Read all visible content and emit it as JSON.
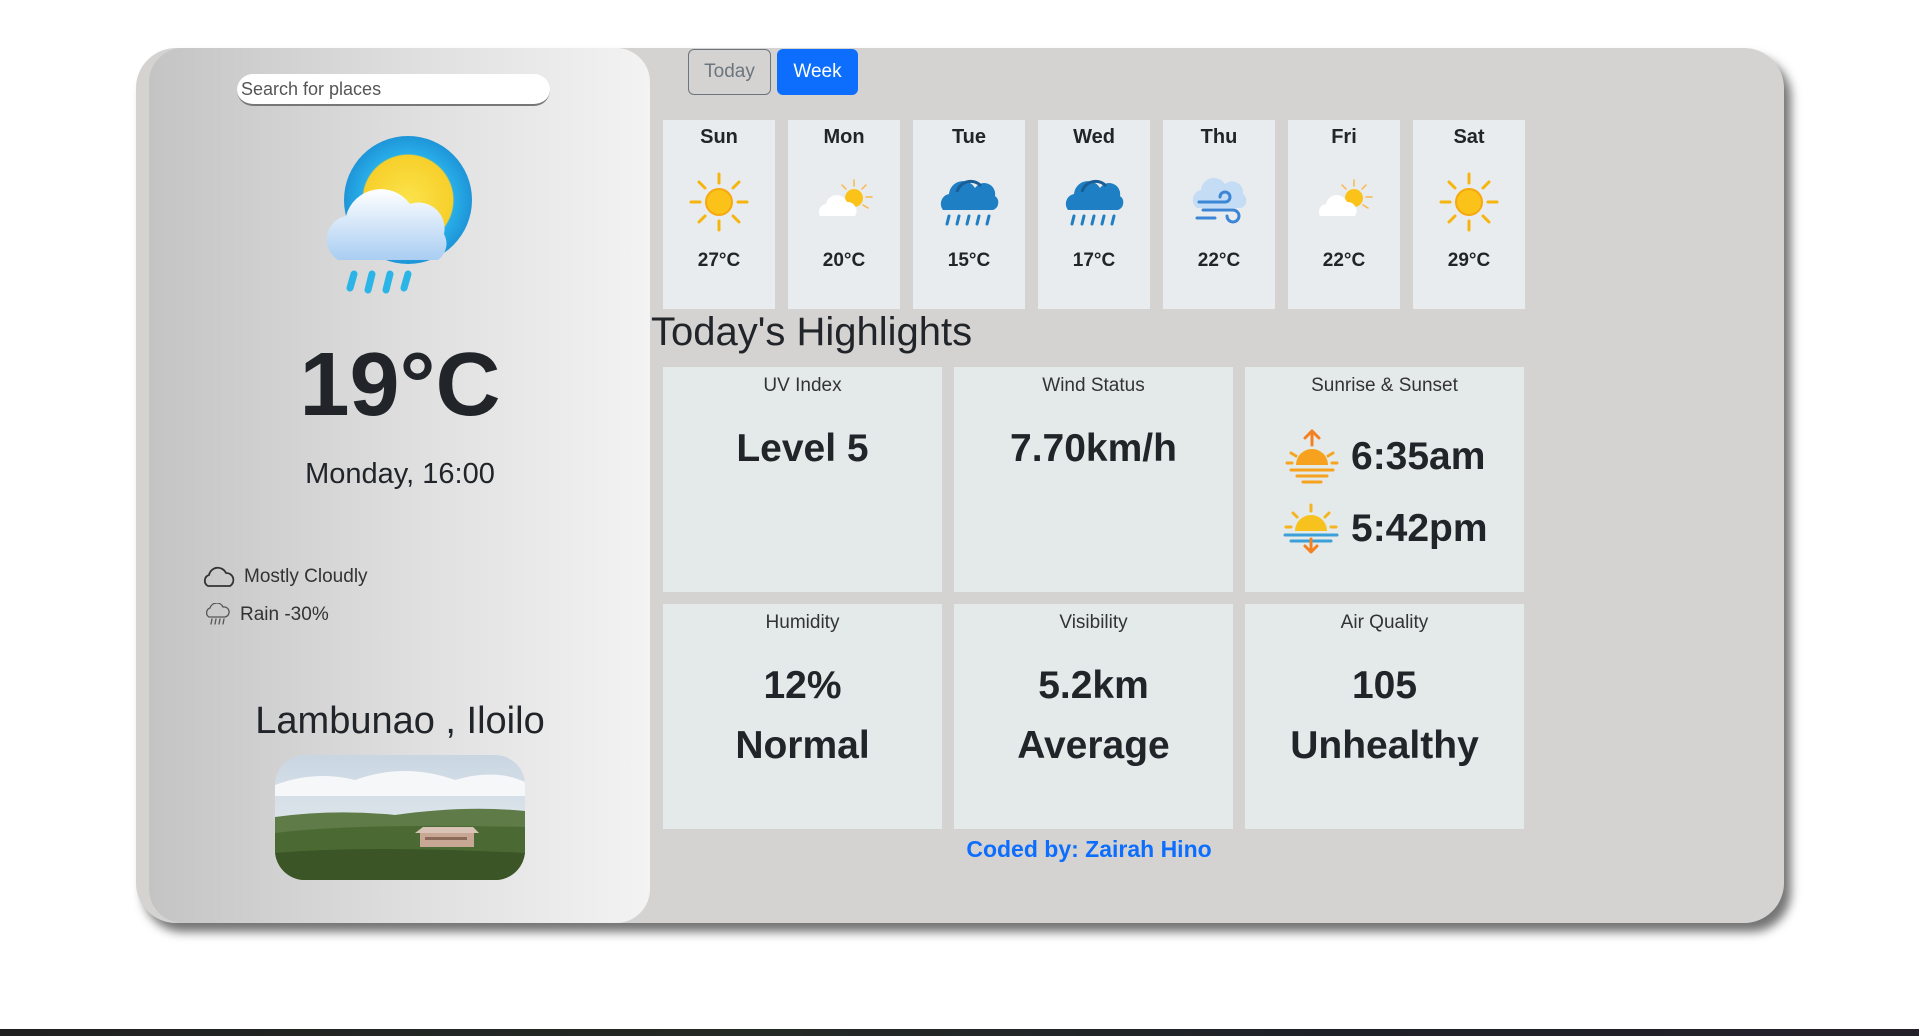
{
  "search": {
    "placeholder": "Search for places"
  },
  "current": {
    "icon": "cloud-rain-sun-icon",
    "temperature": "19°C",
    "datetime": "Monday, 16:00",
    "condition": "Mostly Cloudly",
    "rain": "Rain -30%",
    "location": "Lambunao , Iloilo"
  },
  "tabs": {
    "today": "Today",
    "week": "Week",
    "active": "week"
  },
  "forecast": [
    {
      "day": "Sun",
      "temp": "27°C",
      "icon": "sun-icon"
    },
    {
      "day": "Mon",
      "temp": "20°C",
      "icon": "partly-cloudy-icon"
    },
    {
      "day": "Tue",
      "temp": "15°C",
      "icon": "rain-cloud-icon"
    },
    {
      "day": "Wed",
      "temp": "17°C",
      "icon": "rain-cloud-icon"
    },
    {
      "day": "Thu",
      "temp": "22°C",
      "icon": "wind-cloud-icon"
    },
    {
      "day": "Fri",
      "temp": "22°C",
      "icon": "partly-cloudy-icon"
    },
    {
      "day": "Sat",
      "temp": "29°C",
      "icon": "sun-icon"
    }
  ],
  "highlights": {
    "title": "Today's Highlights",
    "uv": {
      "label": "UV Index",
      "value": "Level 5"
    },
    "wind": {
      "label": "Wind Status",
      "value": "7.70km/h"
    },
    "sun": {
      "label": "Sunrise & Sunset",
      "sunrise": "6:35am",
      "sunset": "5:42pm"
    },
    "humidity": {
      "label": "Humidity",
      "value": "12%",
      "status": "Normal"
    },
    "visibility": {
      "label": "Visibility",
      "value": "5.2km",
      "status": "Average"
    },
    "air": {
      "label": "Air Quality",
      "value": "105",
      "status": "Unhealthy"
    }
  },
  "footer": {
    "credit": "Coded by: Zairah Hino"
  },
  "colors": {
    "accent": "#0d6efd",
    "panel": "#d4d3d2",
    "card": "#e9ecef",
    "highlight_card": "#e4eaea"
  }
}
